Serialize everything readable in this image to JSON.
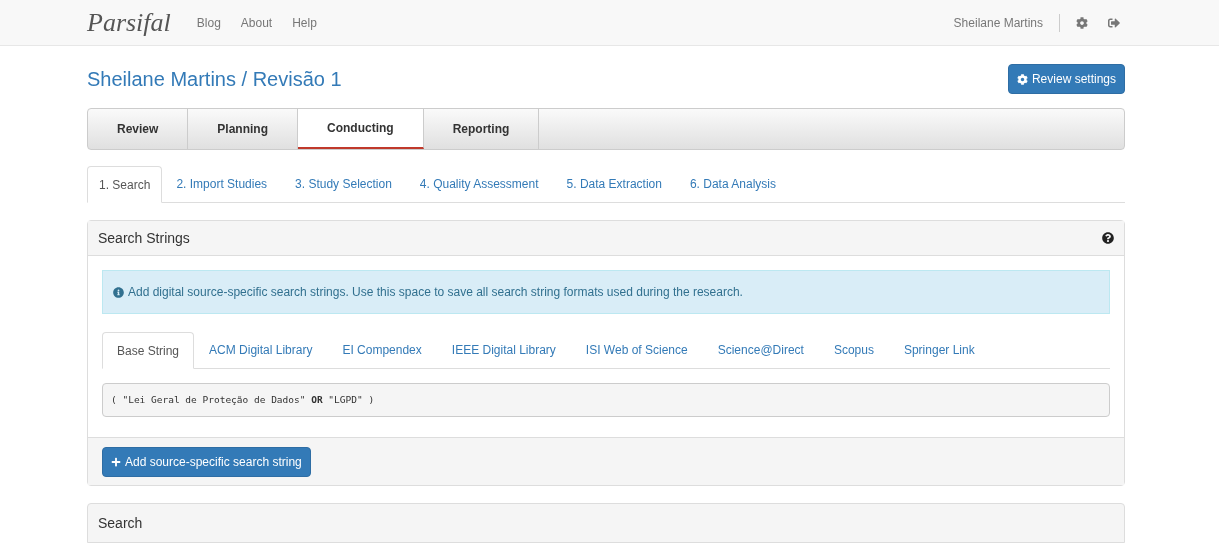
{
  "navbar": {
    "brand": "Parsifal",
    "links": [
      "Blog",
      "About",
      "Help"
    ],
    "user": "Sheilane Martins"
  },
  "header": {
    "title": "Sheilane Martins / Revisão 1",
    "settings_button": "Review settings"
  },
  "main_tabs": [
    {
      "label": "Review",
      "selected": false
    },
    {
      "label": "Planning",
      "selected": false
    },
    {
      "label": "Conducting",
      "selected": true
    },
    {
      "label": "Reporting",
      "selected": false
    }
  ],
  "step_tabs": [
    {
      "label": "1. Search",
      "selected": true
    },
    {
      "label": "2. Import Studies",
      "selected": false
    },
    {
      "label": "3. Study Selection",
      "selected": false
    },
    {
      "label": "4. Quality Assessment",
      "selected": false
    },
    {
      "label": "5. Data Extraction",
      "selected": false
    },
    {
      "label": "6. Data Analysis",
      "selected": false
    }
  ],
  "search_strings_panel": {
    "title": "Search Strings",
    "info": "Add digital source-specific search strings. Use this space to save all search string formats used during the research.",
    "source_tabs": [
      {
        "label": "Base String",
        "selected": true
      },
      {
        "label": "ACM Digital Library",
        "selected": false
      },
      {
        "label": "EI Compendex",
        "selected": false
      },
      {
        "label": "IEEE Digital Library",
        "selected": false
      },
      {
        "label": "ISI Web of Science",
        "selected": false
      },
      {
        "label": "Science@Direct",
        "selected": false
      },
      {
        "label": "Scopus",
        "selected": false
      },
      {
        "label": "Springer Link",
        "selected": false
      }
    ],
    "search_string": "( \"Lei Geral de Proteção de Dados\" **OR** \"LGPD\" )",
    "add_button": "Add source-specific search string"
  },
  "search_panel": {
    "title": "Search"
  }
}
